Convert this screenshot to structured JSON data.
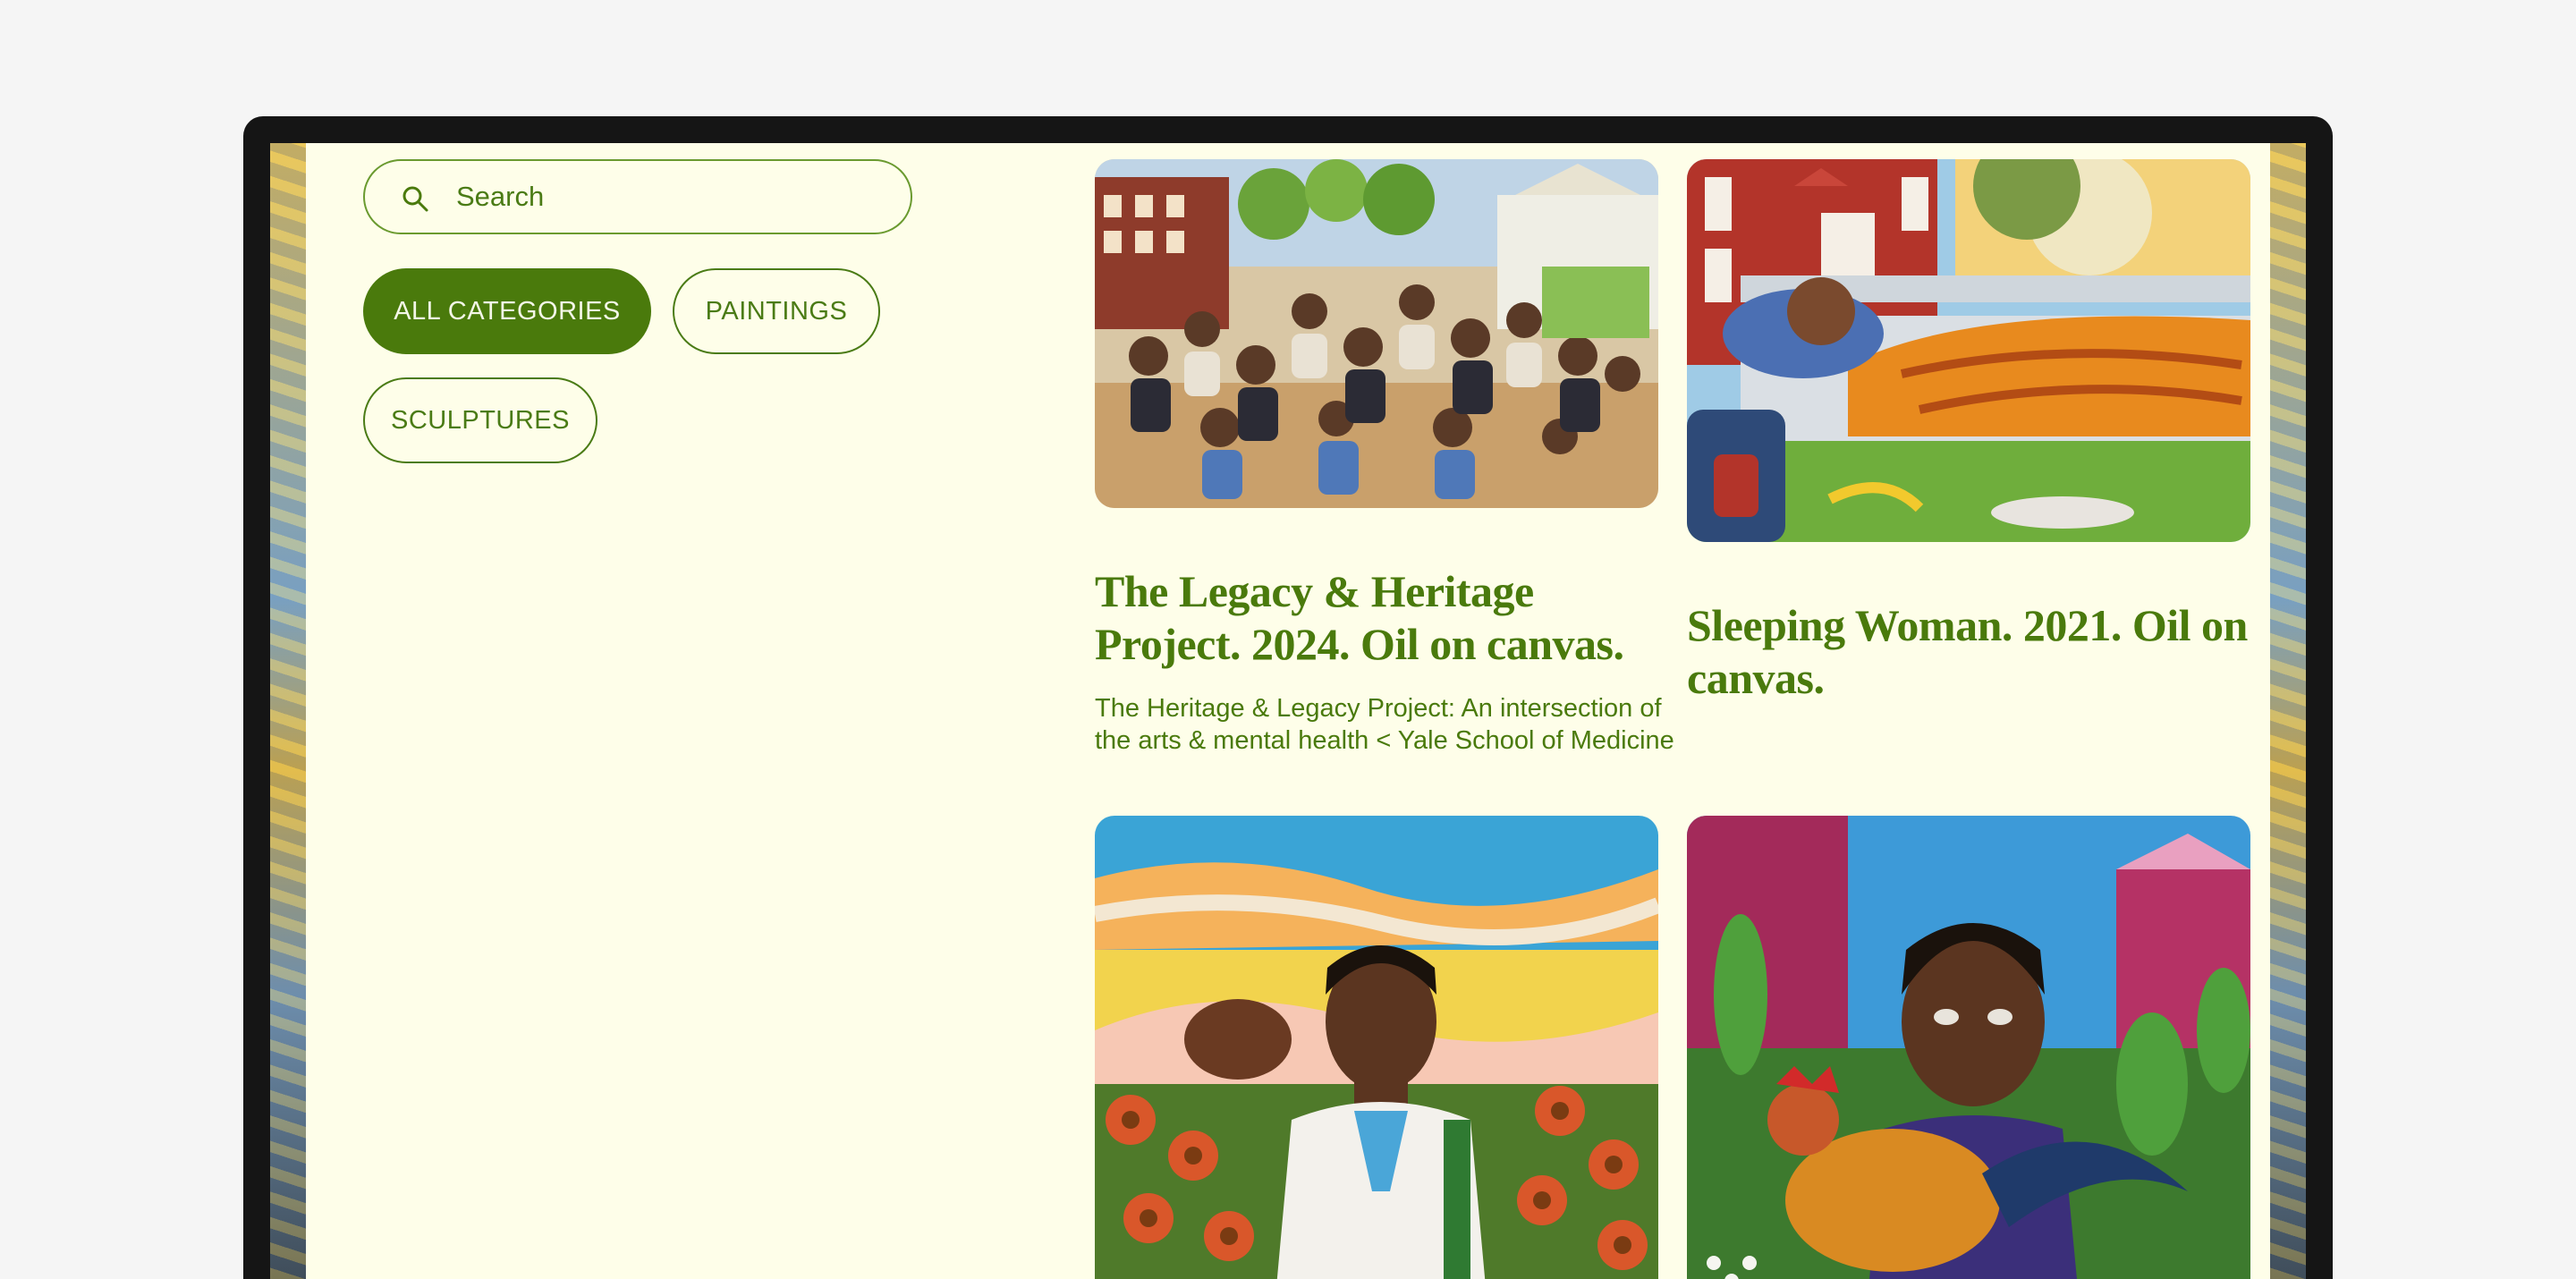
{
  "search": {
    "placeholder": "Search",
    "value": ""
  },
  "filters": {
    "items": [
      {
        "label": "ALL CATEGORIES",
        "active": true
      },
      {
        "label": "PAINTINGS",
        "active": false
      },
      {
        "label": "SCULPTURES",
        "active": false
      }
    ]
  },
  "artworks": [
    {
      "title": "The Legacy & Heritage Project. 2024. Oil on canvas.",
      "description": "The Heritage & Legacy Project: An intersection of the arts & mental health < Yale School of Medicine",
      "image": "group-portrait-painting"
    },
    {
      "title": "Sleeping Woman. 2021. Oil on canvas.",
      "description": "",
      "image": "sleeping-woman-painting"
    },
    {
      "title": "",
      "description": "",
      "image": "man-in-white-coat-painting"
    },
    {
      "title": "",
      "description": "",
      "image": "girl-with-rooster-painting"
    }
  ],
  "colors": {
    "accent": "#4a7a0c",
    "page_background": "#fefee9"
  }
}
